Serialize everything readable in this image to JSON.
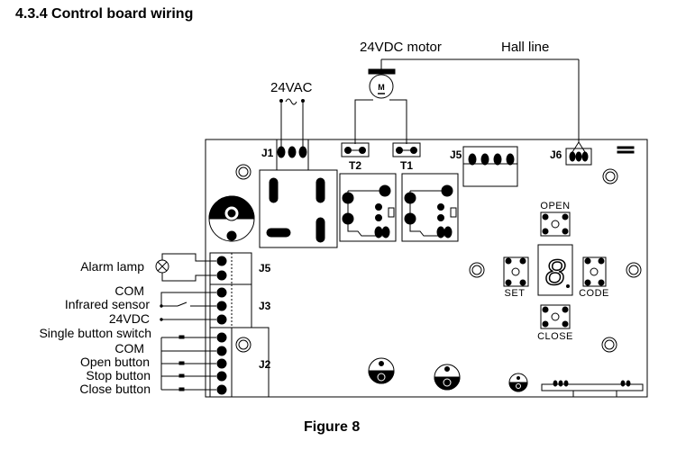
{
  "heading": "4.3.4 Control board wiring",
  "caption": "Figure 8",
  "power_label": "24VAC",
  "motor_label": "24VDC motor",
  "motor_symbol": "M",
  "hall_label": "Hall line",
  "connectors": {
    "j1": "J1",
    "t2": "T2",
    "t1": "T1",
    "j5_top": "J5",
    "j6": "J6",
    "j5_side": "J5",
    "j3": "J3",
    "j2": "J2"
  },
  "external_labels": {
    "alarm_lamp": "Alarm lamp",
    "com_1": "COM",
    "infrared_sensor": "Infrared sensor",
    "vdc24": "24VDC",
    "single_button": "Single button switch",
    "com_2": "COM",
    "open_button": "Open button",
    "stop_button": "Stop button",
    "close_button": "Close button"
  },
  "keypad": {
    "open": "OPEN",
    "set": "SET",
    "code": "CODE",
    "close": "CLOSE",
    "display_digit": "8"
  }
}
